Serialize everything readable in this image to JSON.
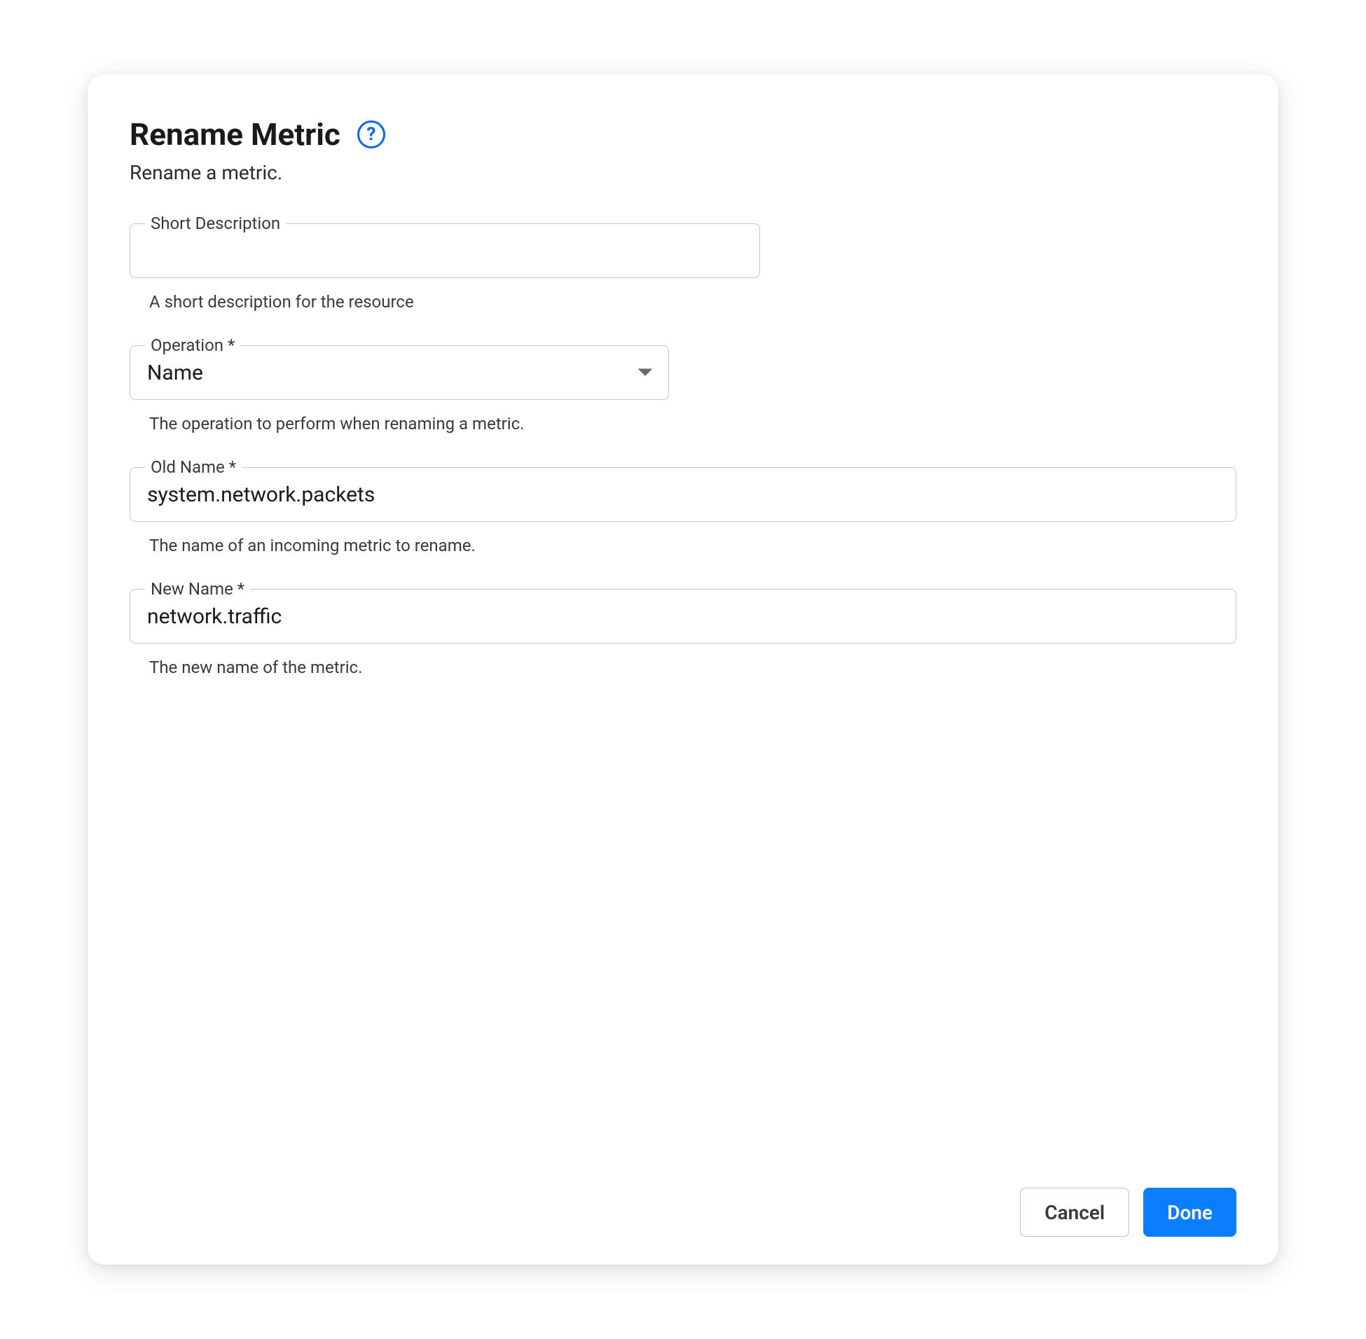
{
  "dialog": {
    "title": "Rename Metric",
    "subtitle": "Rename a metric.",
    "help_icon": "?"
  },
  "fields": {
    "short_description": {
      "label": "Short Description",
      "value": "",
      "helper": "A short description for the resource"
    },
    "operation": {
      "label": "Operation *",
      "value": "Name",
      "helper": "The operation to perform when renaming a metric."
    },
    "old_name": {
      "label": "Old Name *",
      "value": "system.network.packets",
      "helper": "The name of an incoming metric to rename."
    },
    "new_name": {
      "label": "New Name *",
      "value": "network.traffic",
      "helper": "The new name of the metric."
    }
  },
  "footer": {
    "cancel_label": "Cancel",
    "done_label": "Done"
  }
}
